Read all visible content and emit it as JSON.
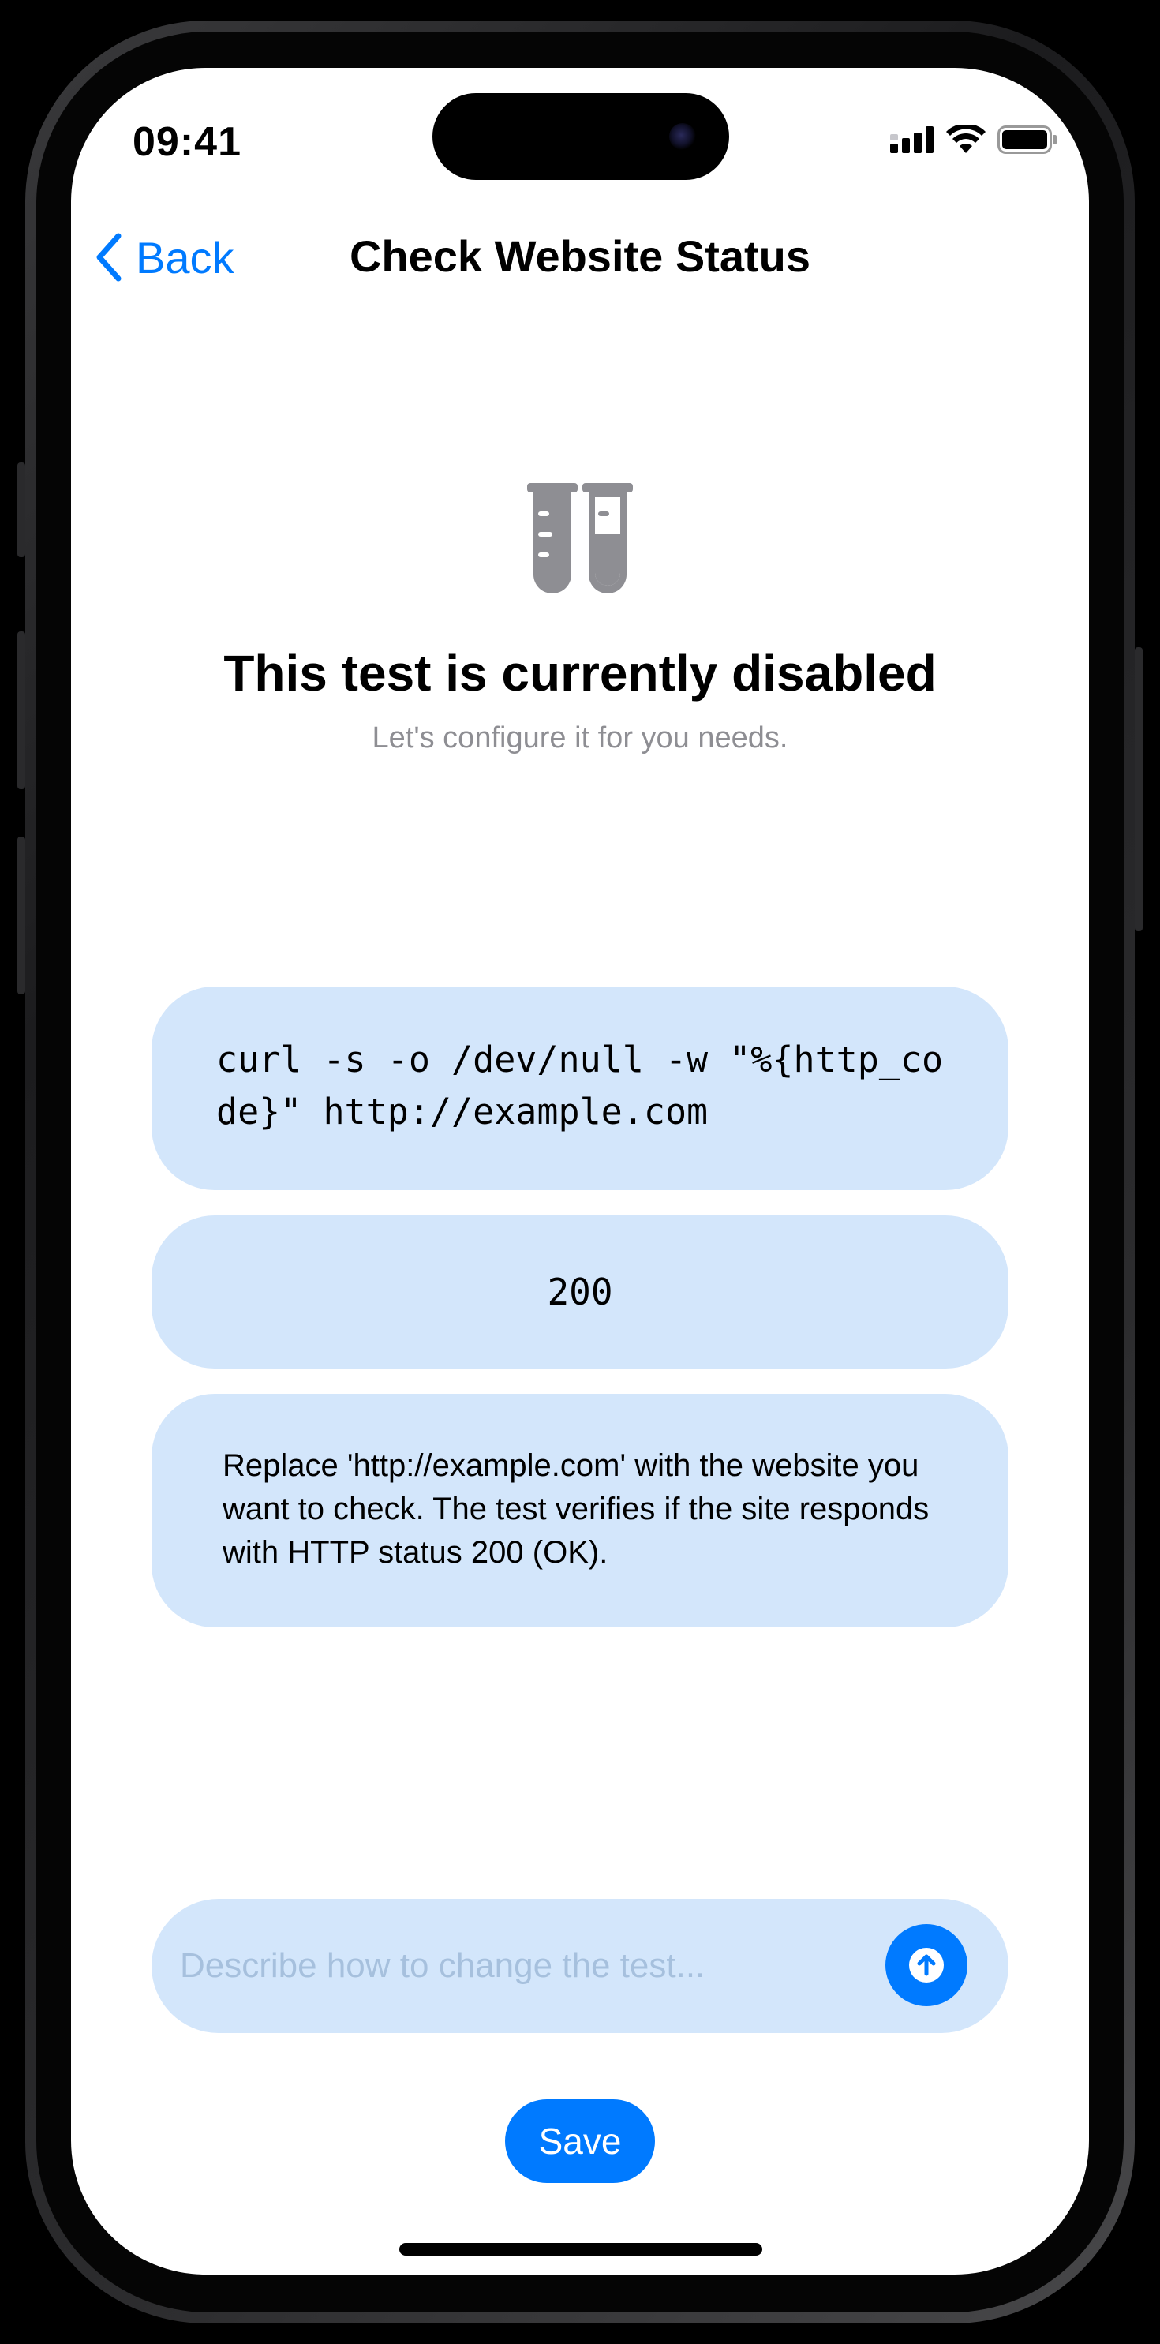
{
  "status_bar": {
    "time": "09:41"
  },
  "nav": {
    "back_label": "Back",
    "title": "Check Website Status"
  },
  "hero": {
    "icon": "test-tubes-icon",
    "title": "This test is currently disabled",
    "subtitle": "Let's configure it for you needs."
  },
  "cards": {
    "command": "curl -s -o /dev/null -w \"%{http_code}\" http://example.com",
    "expected": "200",
    "note": "Replace 'http://example.com' with the website you want to check. The test verifies if the site responds with HTTP status 200 (OK)."
  },
  "prompt": {
    "placeholder": "Describe how to change the test...",
    "value": ""
  },
  "actions": {
    "save_label": "Save"
  },
  "colors": {
    "accent": "#007AFF",
    "card_background": "#D3E6FB",
    "secondary_text": "#8E8E93",
    "icon_gray": "#8E8E93"
  }
}
